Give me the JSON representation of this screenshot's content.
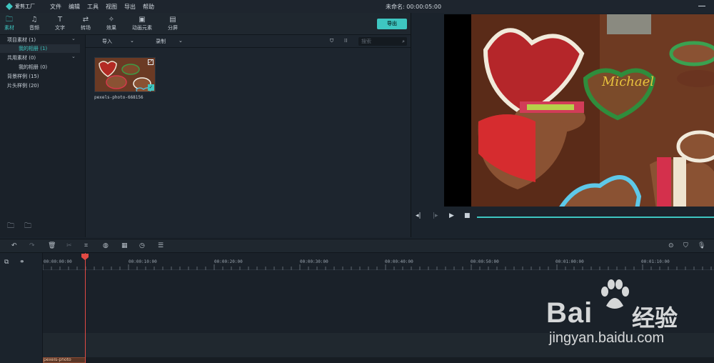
{
  "app": {
    "logo_text": "爱剪工厂",
    "doc_title": "未命名: 00:00:05:00"
  },
  "menu": [
    "文件",
    "编辑",
    "工具",
    "视图",
    "导出",
    "帮助"
  ],
  "tabs": [
    {
      "label": "素材",
      "icon": "folder-icon",
      "active": true
    },
    {
      "label": "音频",
      "icon": "music-note-icon",
      "active": false
    },
    {
      "label": "文字",
      "icon": "text-icon",
      "active": false
    },
    {
      "label": "转场",
      "icon": "transition-icon",
      "active": false
    },
    {
      "label": "效果",
      "icon": "effects-icon",
      "active": false
    },
    {
      "label": "动画元素",
      "icon": "image-icon",
      "active": false
    },
    {
      "label": "分屏",
      "icon": "split-screen-icon",
      "active": false
    }
  ],
  "export_label": "导出",
  "tree": {
    "project": "项目素材 (1)",
    "my_album_1": "我的相册 (1)",
    "shared": "共用素材 (0)",
    "my_album_2": "我的相册 (0)",
    "bg_samples": "背景样例 (15)",
    "title_samples": "片头样例 (20)"
  },
  "toolbar": {
    "import": "导入",
    "record": "录制",
    "search_placeholder": "搜索"
  },
  "media": {
    "filename": "pexels-photo-668156"
  },
  "timeline": {
    "ruler": [
      "00:00:00:00",
      "00:00:10:00",
      "00:00:20:00",
      "00:00:30:00",
      "00:00:40:00",
      "00:00:50:00",
      "00:01:00:00",
      "00:01:10:00"
    ],
    "clip_label": "pexels-photo"
  },
  "watermark": {
    "brand": "Bai",
    "cn": "经验",
    "url": "jingyan.baidu.com"
  },
  "colors": {
    "accent": "#3ec6c1",
    "playhead": "#e24a44"
  }
}
